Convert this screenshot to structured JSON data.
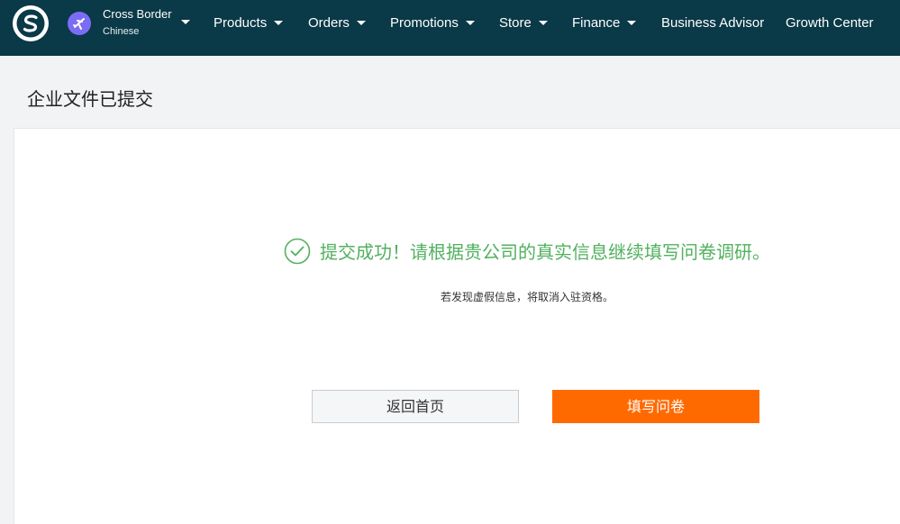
{
  "topbar": {
    "channel": {
      "name": "Cross Border",
      "language": "Chinese"
    },
    "nav": [
      {
        "label": "Products",
        "has_dropdown": true
      },
      {
        "label": "Orders",
        "has_dropdown": true
      },
      {
        "label": "Promotions",
        "has_dropdown": true
      },
      {
        "label": "Store",
        "has_dropdown": true
      },
      {
        "label": "Finance",
        "has_dropdown": true
      },
      {
        "label": "Business Advisor",
        "has_dropdown": false
      },
      {
        "label": "Growth Center",
        "has_dropdown": false
      }
    ],
    "icons": {
      "logo": "brand-s-logo-icon",
      "channel": "airplane-icon",
      "dropdown": "caret-down-icon"
    },
    "colors": {
      "background": "#0a3947",
      "channel_icon": "#7b6cf6"
    }
  },
  "page": {
    "title": "企业文件已提交"
  },
  "result": {
    "icon": "check-circle-icon",
    "message": "提交成功！请根据贵公司的真实信息继续填写问卷调研。",
    "note": "若发现虚假信息，将取消入驻资格。",
    "colors": {
      "success": "#52b05f"
    }
  },
  "actions": {
    "back_home": "返回首页",
    "fill_survey": "填写问卷",
    "colors": {
      "primary": "#ff6a00"
    }
  }
}
